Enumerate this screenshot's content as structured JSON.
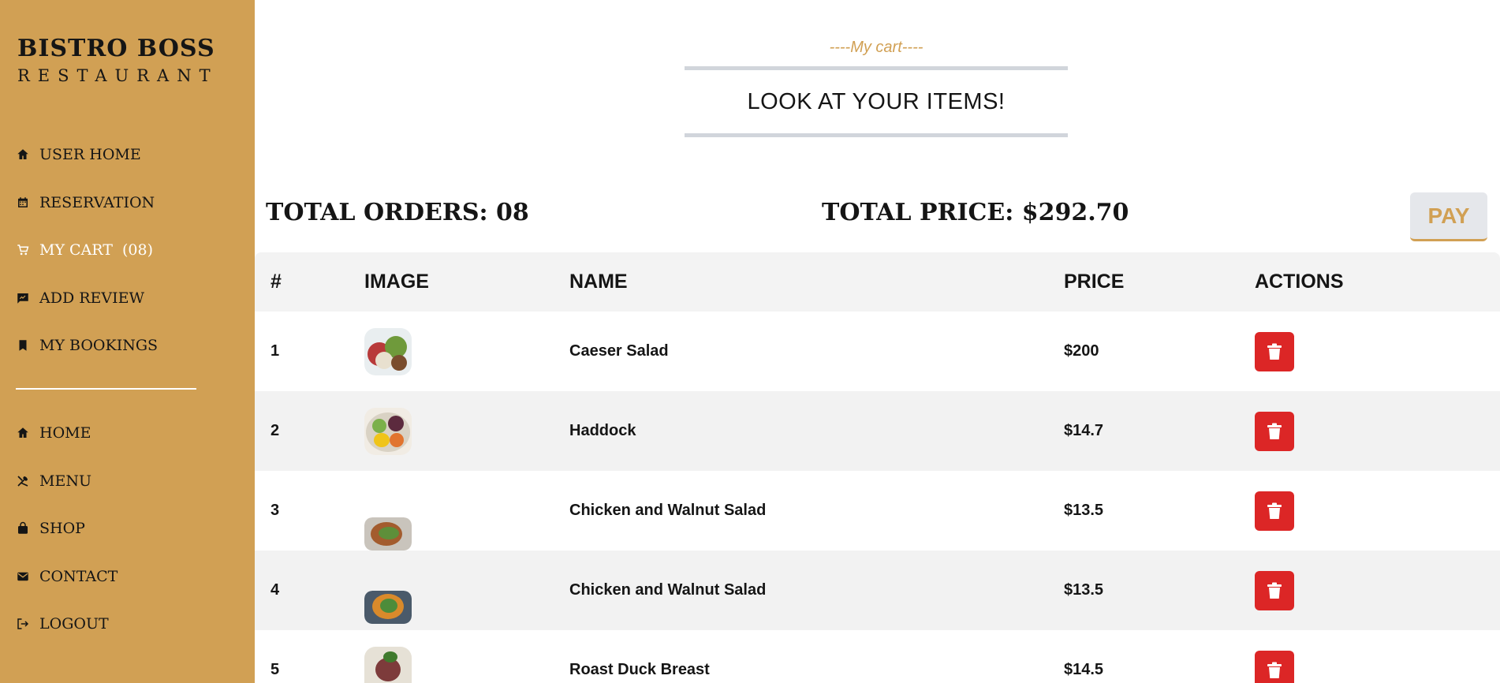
{
  "brand": {
    "title": "BISTRO BOSS",
    "subtitle": "RESTAURANT"
  },
  "sidebar": {
    "top_items": [
      {
        "label": "USER HOME",
        "icon": "home-icon"
      },
      {
        "label": "RESERVATION",
        "icon": "calendar-icon"
      },
      {
        "label": "MY CART  (08)",
        "icon": "cart-icon",
        "active": true
      },
      {
        "label": "ADD REVIEW",
        "icon": "review-icon"
      },
      {
        "label": "MY BOOKINGS",
        "icon": "bookmark-icon"
      }
    ],
    "bottom_items": [
      {
        "label": "HOME",
        "icon": "home-icon"
      },
      {
        "label": "MENU",
        "icon": "utensils-icon"
      },
      {
        "label": "SHOP",
        "icon": "bag-icon"
      },
      {
        "label": "CONTACT",
        "icon": "mail-icon"
      },
      {
        "label": "LOGOUT",
        "icon": "logout-icon"
      }
    ]
  },
  "header": {
    "subheading": "----My cart----",
    "heading": "LOOK AT YOUR ITEMS!"
  },
  "summary": {
    "total_orders": "TOTAL ORDERS: 08",
    "total_price": "TOTAL PRICE: $292.70",
    "pay_label": "PAY"
  },
  "table": {
    "headers": {
      "idx": "#",
      "image": "IMAGE",
      "name": "NAME",
      "price": "PRICE",
      "actions": "ACTIONS"
    },
    "rows": [
      {
        "idx": "1",
        "name": "Caeser Salad",
        "price": "$200"
      },
      {
        "idx": "2",
        "name": "Haddock",
        "price": "$14.7"
      },
      {
        "idx": "3",
        "name": "Chicken and Walnut Salad",
        "price": "$13.5"
      },
      {
        "idx": "4",
        "name": "Chicken and Walnut Salad",
        "price": "$13.5"
      },
      {
        "idx": "5",
        "name": "Roast Duck Breast",
        "price": "$14.5"
      }
    ]
  },
  "colors": {
    "brand": "#d1a054",
    "danger": "#dc2626",
    "text": "#151515"
  }
}
